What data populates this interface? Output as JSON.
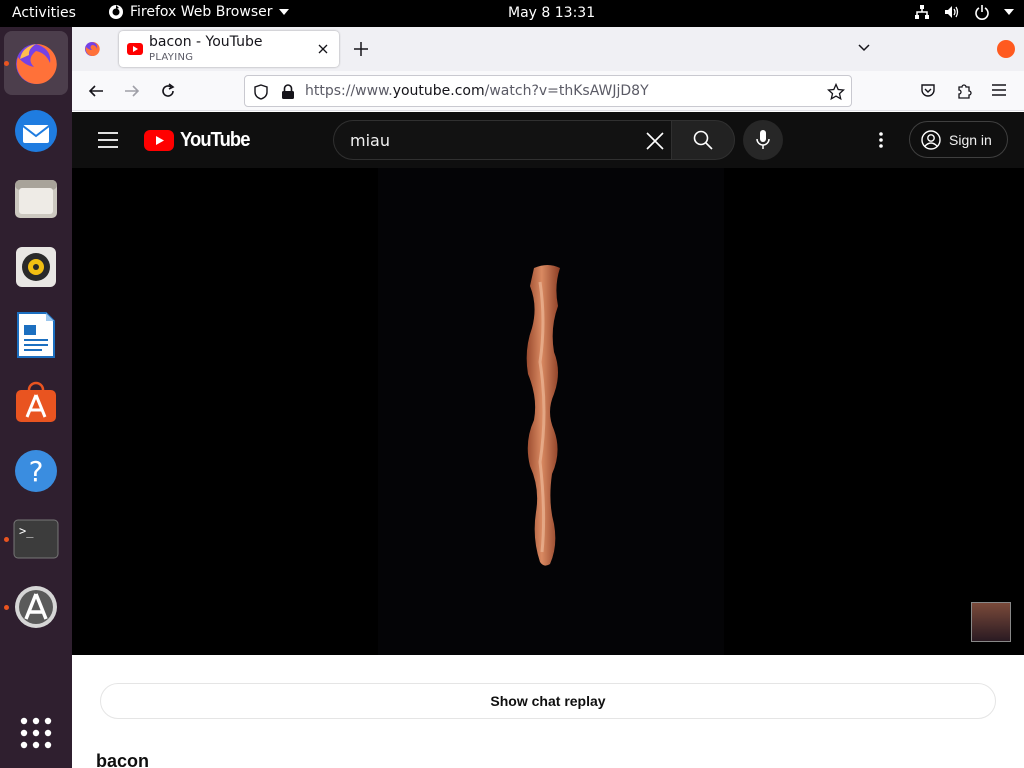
{
  "topbar": {
    "activities": "Activities",
    "app_name": "Firefox Web Browser",
    "clock": "May 8  13:31"
  },
  "dock": {
    "items": [
      "firefox",
      "thunderbird",
      "files",
      "rhythmbox",
      "libreoffice-writer",
      "ubuntu-software",
      "help",
      "terminal",
      "software-updater",
      "show-apps"
    ],
    "running": [
      "firefox",
      "terminal",
      "software-updater"
    ]
  },
  "browser": {
    "tab": {
      "title": "bacon - YouTube",
      "status": "PLAYING"
    },
    "url": {
      "prefix": "https://www.",
      "host": "youtube.com",
      "path": "/watch?v=thKsAWJjD8Y"
    }
  },
  "youtube": {
    "logo_text": "YouTube",
    "search_value": "miau",
    "signin_label": "Sign in",
    "chat_replay_label": "Show chat replay",
    "video_title": "bacon"
  },
  "colors": {
    "youtube_red": "#ff0000",
    "ubuntu_orange": "#e95420",
    "dock_bg": "#2f1f2f"
  }
}
